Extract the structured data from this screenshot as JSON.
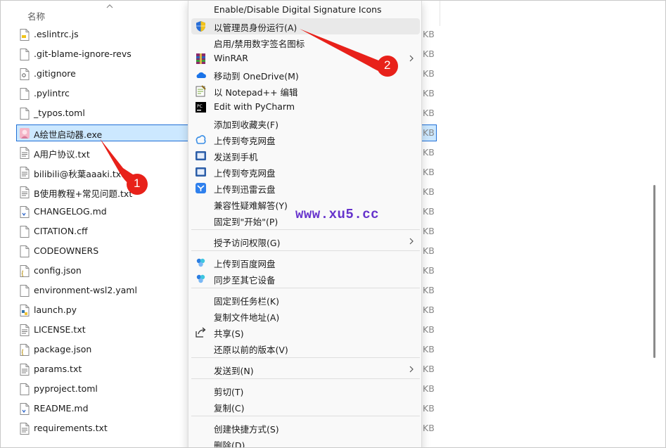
{
  "header": {
    "name_col": "名称"
  },
  "files": [
    {
      "name": ".eslintrc.js",
      "size": "KB",
      "icon": "js-file-icon"
    },
    {
      "name": ".git-blame-ignore-revs",
      "size": "KB",
      "icon": "file-icon"
    },
    {
      "name": ".gitignore",
      "size": "KB",
      "icon": "config-file-icon"
    },
    {
      "name": ".pylintrc",
      "size": "KB",
      "icon": "file-icon"
    },
    {
      "name": "_typos.toml",
      "size": "KB",
      "icon": "file-icon"
    },
    {
      "name": "A绘世启动器.exe",
      "size": "KB",
      "icon": "app-icon",
      "selected": true
    },
    {
      "name": "A用户协议.txt",
      "size": "KB",
      "icon": "text-file-icon"
    },
    {
      "name": "bilibili@秋葉aaaki.txt",
      "size": "KB",
      "icon": "text-file-icon"
    },
    {
      "name": "B使用教程+常见问题.txt",
      "size": "KB",
      "icon": "text-file-icon"
    },
    {
      "name": "CHANGELOG.md",
      "size": "KB",
      "icon": "md-file-icon"
    },
    {
      "name": "CITATION.cff",
      "size": "KB",
      "icon": "file-icon"
    },
    {
      "name": "CODEOWNERS",
      "size": "KB",
      "icon": "file-icon"
    },
    {
      "name": "config.json",
      "size": "KB",
      "icon": "json-file-icon"
    },
    {
      "name": "environment-wsl2.yaml",
      "size": "KB",
      "icon": "file-icon"
    },
    {
      "name": "launch.py",
      "size": "KB",
      "icon": "python-file-icon"
    },
    {
      "name": "LICENSE.txt",
      "size": "KB",
      "icon": "text-file-icon"
    },
    {
      "name": "package.json",
      "size": "KB",
      "icon": "json-file-icon"
    },
    {
      "name": "params.txt",
      "size": "KB",
      "icon": "text-file-icon"
    },
    {
      "name": "pyproject.toml",
      "size": "KB",
      "icon": "file-icon"
    },
    {
      "name": "README.md",
      "size": "KB",
      "icon": "md-file-icon"
    },
    {
      "name": "requirements.txt",
      "size": "KB",
      "icon": "text-file-icon"
    }
  ],
  "menu": {
    "items": [
      {
        "label": "Enable/Disable Digital Signature Icons",
        "icon": ""
      },
      {
        "label": "以管理员身份运行(A)",
        "icon": "uac-shield-icon"
      },
      {
        "label": "启用/禁用数字签名图标",
        "icon": ""
      },
      {
        "label": "WinRAR",
        "icon": "winrar-icon",
        "submenu": true
      },
      {
        "label": "移动到 OneDrive(M)",
        "icon": "onedrive-icon"
      },
      {
        "label": "以 Notepad++ 编辑",
        "icon": "notepadpp-icon"
      },
      {
        "label": "Edit with PyCharm",
        "icon": "pycharm-icon"
      },
      {
        "label": "添加到收藏夹(F)",
        "icon": ""
      },
      {
        "label": "上传到夸克网盘",
        "icon": "quark-icon"
      },
      {
        "label": "发送到手机",
        "icon": "phone-send-icon"
      },
      {
        "label": "上传到夸克网盘",
        "icon": "quark-upload-icon"
      },
      {
        "label": "上传到迅雷云盘",
        "icon": "xunlei-icon"
      },
      {
        "label": "兼容性疑难解答(Y)",
        "icon": ""
      },
      {
        "label": "固定到\"开始\"(P)",
        "icon": ""
      },
      {
        "label": "授予访问权限(G)",
        "icon": "",
        "submenu": true
      },
      {
        "label": "上传到百度网盘",
        "icon": "baidu-netdisk-icon"
      },
      {
        "label": "同步至其它设备",
        "icon": "baidu-sync-icon"
      },
      {
        "label": "固定到任务栏(K)",
        "icon": ""
      },
      {
        "label": "复制文件地址(A)",
        "icon": ""
      },
      {
        "label": "共享(S)",
        "icon": "share-icon"
      },
      {
        "label": "还原以前的版本(V)",
        "icon": ""
      },
      {
        "label": "发送到(N)",
        "icon": "",
        "submenu": true
      },
      {
        "label": "剪切(T)",
        "icon": ""
      },
      {
        "label": "复制(C)",
        "icon": ""
      },
      {
        "label": "创建快捷方式(S)",
        "icon": ""
      },
      {
        "label": "删除(D)",
        "icon": ""
      }
    ]
  },
  "annotations": {
    "badge1": "1",
    "badge2": "2"
  },
  "watermark": "www.xu5.cc",
  "colors": {
    "selection_bg": "#cce8ff",
    "selection_border": "#1f6fd6",
    "arrow_red": "#e8211a",
    "watermark": "#6633cc",
    "menu_bg": "#f9f9f9"
  }
}
